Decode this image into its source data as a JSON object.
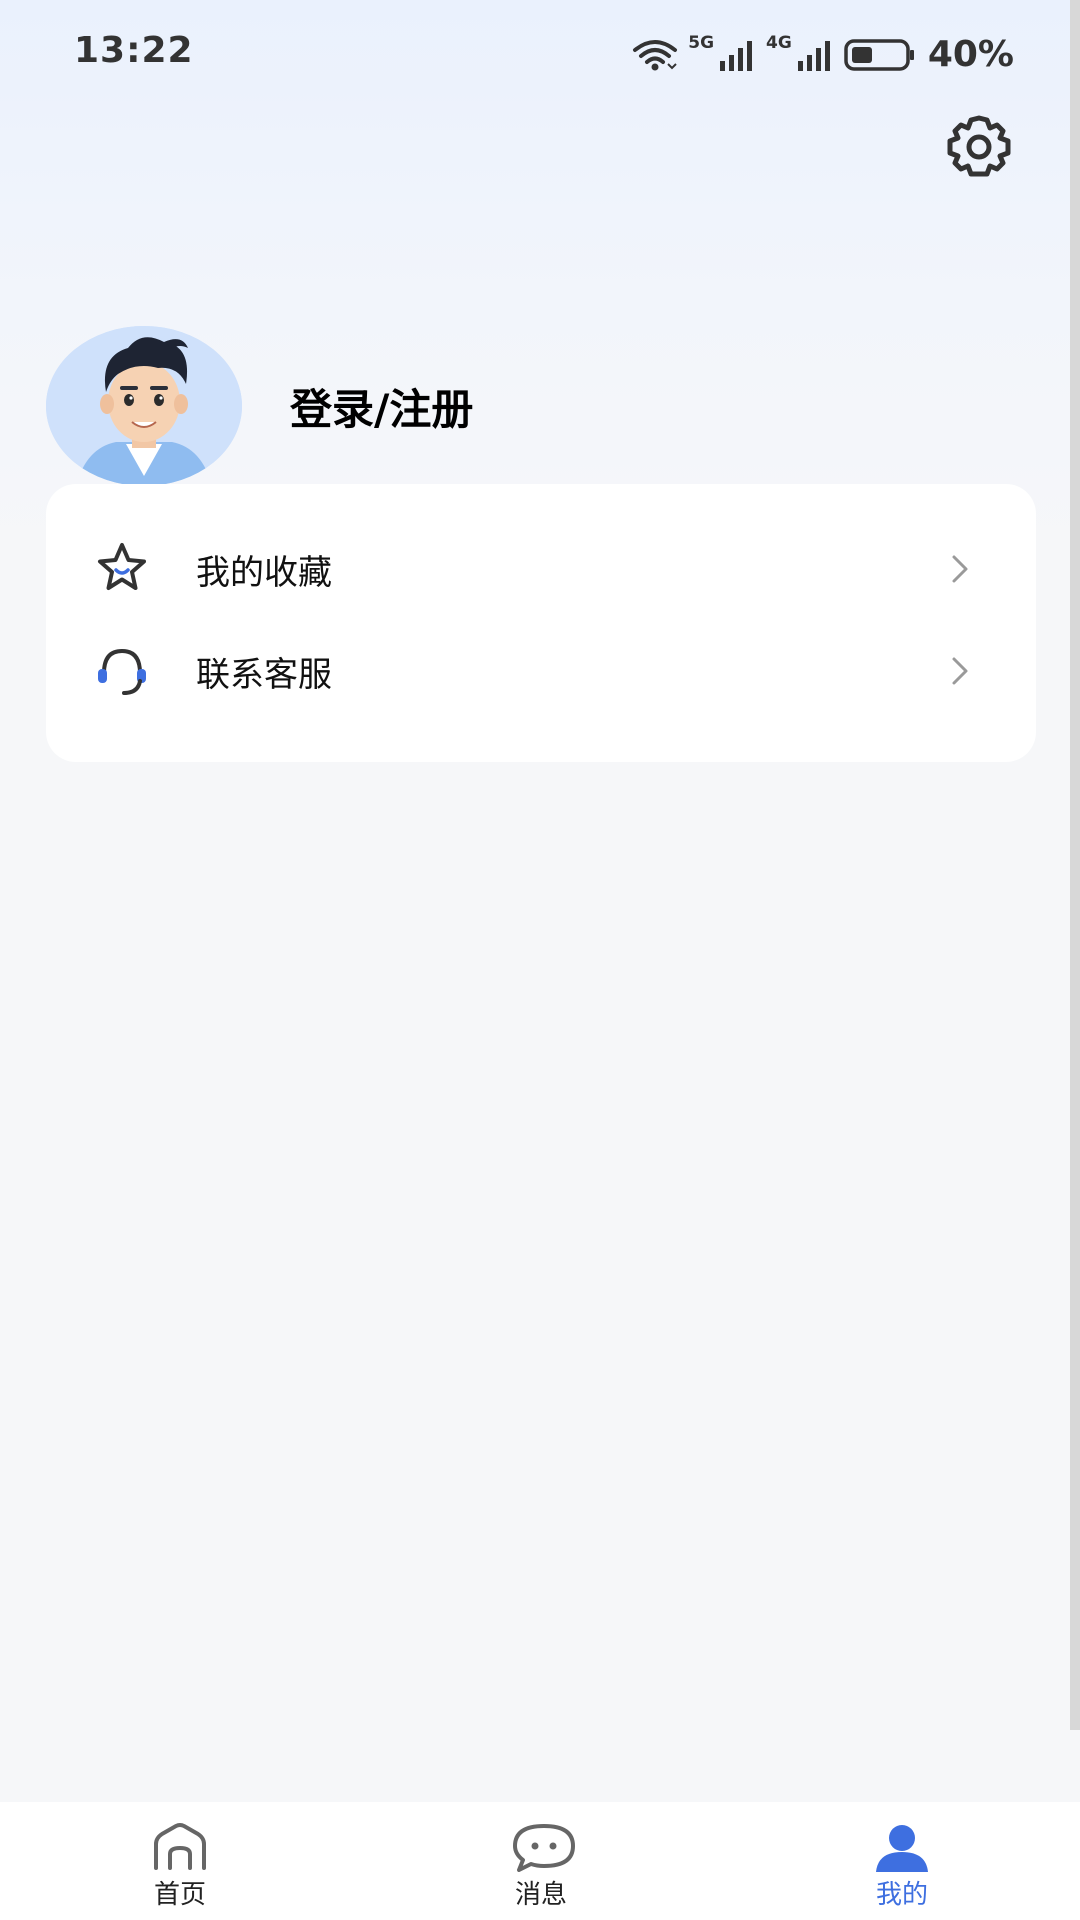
{
  "status_bar": {
    "time": "13:22",
    "net_5g": "5G",
    "net_4g": "4G",
    "battery": "40%"
  },
  "header": {
    "settings_icon": "gear-icon"
  },
  "profile": {
    "login_text": "登录/注册",
    "avatar_icon": "cartoon-avatar"
  },
  "menu": {
    "items": [
      {
        "label": "我的收藏",
        "icon": "star-icon"
      },
      {
        "label": "联系客服",
        "icon": "headset-icon"
      }
    ]
  },
  "bottom_nav": {
    "items": [
      {
        "label": "首页",
        "icon": "home-icon"
      },
      {
        "label": "消息",
        "icon": "message-icon"
      },
      {
        "label": "我的",
        "icon": "user-icon"
      }
    ],
    "active_index": 2,
    "active_color": "#3e6fe0"
  }
}
